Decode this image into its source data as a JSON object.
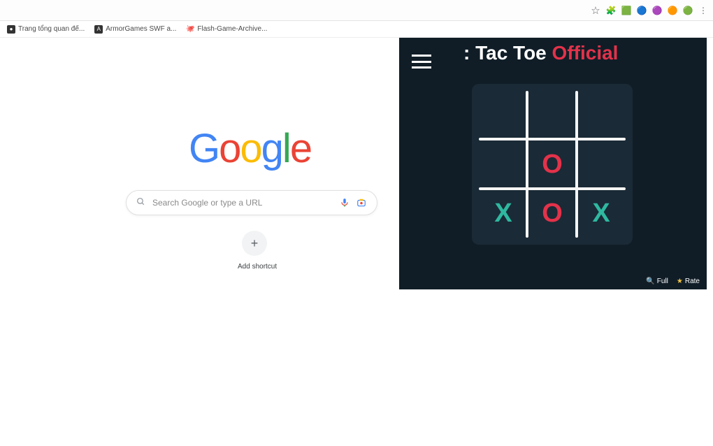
{
  "chrome": {
    "star_icon": "☆",
    "extension_icons": [
      "🧩",
      "🟩",
      "🔵",
      "🟣",
      "🟠",
      "🟢",
      "⋮"
    ]
  },
  "bookmarks": [
    {
      "favicon_class": "fav-dark",
      "favicon": "●",
      "label": "Trang tổng quan đế..."
    },
    {
      "favicon_class": "fav-dark",
      "favicon": "A",
      "label": "ArmorGames SWF a..."
    },
    {
      "favicon_class": "fav-gh",
      "favicon": "🐙",
      "label": "Flash-Game-Archive..."
    }
  ],
  "google": {
    "logo_chars": [
      "G",
      "o",
      "o",
      "g",
      "l",
      "e"
    ],
    "placeholder": "Search Google or type a URL",
    "shortcut_label": "Add shortcut",
    "plus_glyph": "+"
  },
  "game": {
    "title_part1": ": Tac Toe",
    "title_part2": "Official",
    "board": [
      [
        "",
        "",
        ""
      ],
      [
        "",
        "O",
        ""
      ],
      [
        "X",
        "O",
        "X"
      ]
    ],
    "full_label": "Full",
    "rate_label": "Rate",
    "full_icon": "🔍",
    "rate_icon": "★"
  }
}
